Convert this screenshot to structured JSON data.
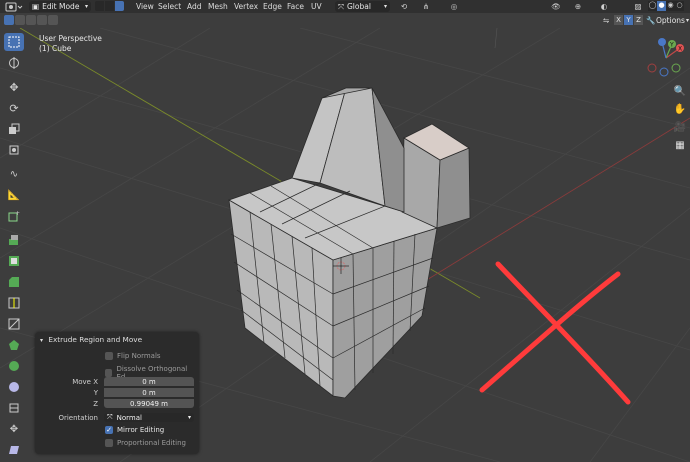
{
  "header": {
    "mode": "Edit Mode",
    "menus": [
      "View",
      "Select",
      "Add",
      "Mesh",
      "Vertex",
      "Edge",
      "Face",
      "UV"
    ],
    "orientation": "Global",
    "options_label": "Options",
    "axes": [
      "X",
      "Y",
      "Z"
    ]
  },
  "viewport": {
    "perspective": "User Perspective",
    "object": "(1) Cube"
  },
  "gizmo": {
    "x": "X",
    "y": "Y",
    "z": "Z"
  },
  "panel": {
    "title": "Extrude Region and Move",
    "flip_normals": "Flip Normals",
    "dissolve": "Dissolve Orthogonal Ed...",
    "move_x_label": "Move X",
    "y_label": "Y",
    "z_label": "Z",
    "move_x": "0 m",
    "move_y": "0 m",
    "move_z": "0.99049 m",
    "orientation_label": "Orientation",
    "orientation": "Normal",
    "mirror": "Mirror Editing",
    "proportional": "Proportional Editing",
    "mirror_checked": true
  },
  "colors": {
    "accent": "#4772b3",
    "annotation": "#ff3b3b",
    "grid_x": "#8a3b3b",
    "grid_y": "#7a8a2a"
  }
}
